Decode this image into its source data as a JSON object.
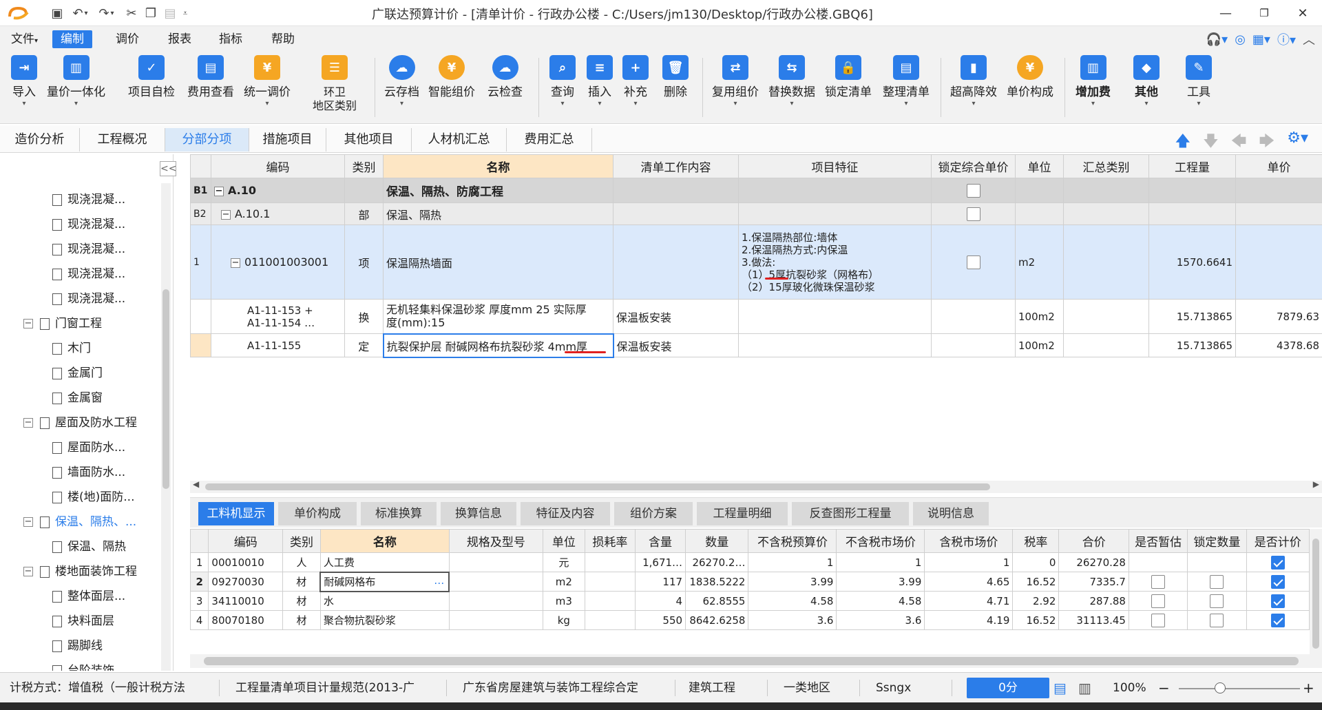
{
  "window": {
    "title": "广联达预算计价 - [清单计价 - 行政办公楼 - C:/Users/jm130/Desktop/行政办公楼.GBQ6]",
    "controls": {
      "minimize": "—",
      "restore": "❐",
      "close": "✕"
    }
  },
  "menu": {
    "items": [
      "文件",
      "编制",
      "调价",
      "报表",
      "指标",
      "帮助"
    ],
    "active": "编制"
  },
  "ribbon": {
    "buttons": [
      {
        "label": "导入",
        "icon": "import-icon",
        "color": "#2b7de9",
        "dd": true
      },
      {
        "label": "量价一体化",
        "icon": "integrate-icon",
        "color": "#2b7de9",
        "dd": true
      },
      {
        "label": "项目自检",
        "icon": "self-check-icon",
        "color": "#2b7de9",
        "dd": false
      },
      {
        "label": "费用查看",
        "icon": "fee-view-icon",
        "color": "#2b7de9",
        "dd": false
      },
      {
        "label": "统一调价",
        "icon": "unify-price-icon",
        "color": "#f5a623",
        "dd": true
      },
      {
        "label": "环卫\n地区类别",
        "icon": "region-icon",
        "color": "#f5a623",
        "dd": false
      },
      {
        "label": "云存档",
        "icon": "cloud-save-icon",
        "color": "#2b7de9",
        "dd": true
      },
      {
        "label": "智能组价",
        "icon": "smart-price-icon",
        "color": "#f5a623",
        "dd": false
      },
      {
        "label": "云检查",
        "icon": "cloud-check-icon",
        "color": "#2b7de9",
        "dd": false
      },
      {
        "label": "查询",
        "icon": "query-icon",
        "color": "#2b7de9",
        "dd": true
      },
      {
        "label": "插入",
        "icon": "insert-icon",
        "color": "#2b7de9",
        "dd": true
      },
      {
        "label": "补充",
        "icon": "supplement-icon",
        "color": "#2b7de9",
        "dd": true
      },
      {
        "label": "删除",
        "icon": "delete-icon",
        "color": "#2b7de9",
        "dd": false
      },
      {
        "label": "复用组价",
        "icon": "reuse-icon",
        "color": "#2b7de9",
        "dd": true
      },
      {
        "label": "替换数据",
        "icon": "replace-icon",
        "color": "#2b7de9",
        "dd": true
      },
      {
        "label": "锁定清单",
        "icon": "lock-icon",
        "color": "#2b7de9",
        "dd": false
      },
      {
        "label": "整理清单",
        "icon": "organize-icon",
        "color": "#2b7de9",
        "dd": true
      },
      {
        "label": "超高降效",
        "icon": "high-icon",
        "color": "#2b7de9",
        "dd": true
      },
      {
        "label": "单价构成",
        "icon": "unit-price-icon",
        "color": "#f5a623",
        "dd": false
      },
      {
        "label": "增加费",
        "icon": "add-fee-icon",
        "color": "#2b7de9",
        "dd": true
      },
      {
        "label": "其他",
        "icon": "other-icon",
        "color": "#2b7de9",
        "dd": true
      },
      {
        "label": "工具",
        "icon": "tool-icon",
        "color": "#2b7de9",
        "dd": true
      }
    ]
  },
  "nav_tabs": {
    "items": [
      "造价分析",
      "工程概况",
      "分部分项",
      "措施项目",
      "其他项目",
      "人材机汇总",
      "费用汇总"
    ],
    "active": "分部分项"
  },
  "tree": {
    "collapse_label": "<<",
    "nodes": [
      {
        "label": "现浇混凝...",
        "level": 2,
        "type": "doc"
      },
      {
        "label": "现浇混凝...",
        "level": 2,
        "type": "doc"
      },
      {
        "label": "现浇混凝...",
        "level": 2,
        "type": "doc"
      },
      {
        "label": "现浇混凝...",
        "level": 2,
        "type": "doc"
      },
      {
        "label": "现浇混凝...",
        "level": 2,
        "type": "doc"
      },
      {
        "label": "门窗工程",
        "level": 1,
        "type": "folder"
      },
      {
        "label": "木门",
        "level": 2,
        "type": "doc"
      },
      {
        "label": "金属门",
        "level": 2,
        "type": "doc"
      },
      {
        "label": "金属窗",
        "level": 2,
        "type": "doc"
      },
      {
        "label": "屋面及防水工程",
        "level": 1,
        "type": "folder"
      },
      {
        "label": "屋面防水...",
        "level": 2,
        "type": "doc"
      },
      {
        "label": "墙面防水...",
        "level": 2,
        "type": "doc"
      },
      {
        "label": "楼(地)面防...",
        "level": 2,
        "type": "doc"
      },
      {
        "label": "保温、隔热、...",
        "level": 1,
        "type": "folder",
        "selected": true
      },
      {
        "label": "保温、隔热",
        "level": 2,
        "type": "doc"
      },
      {
        "label": "楼地面装饰工程",
        "level": 1,
        "type": "folder"
      },
      {
        "label": "整体面层...",
        "level": 2,
        "type": "doc"
      },
      {
        "label": "块料面层",
        "level": 2,
        "type": "doc"
      },
      {
        "label": "踢脚线",
        "level": 2,
        "type": "doc"
      },
      {
        "label": "台阶装饰",
        "level": 2,
        "type": "doc"
      }
    ]
  },
  "main_grid": {
    "headers": [
      "编码",
      "类别",
      "名称",
      "清单工作内容",
      "项目特征",
      "锁定综合单价",
      "单位",
      "汇总类别",
      "工程量",
      "单价"
    ],
    "rows": [
      {
        "idx": "B1",
        "code": "A.10",
        "type": "",
        "name": "保温、隔热、防腐工程",
        "content": "",
        "feature": "",
        "lock": false,
        "unit": "",
        "sum": "",
        "qty": "",
        "price": ""
      },
      {
        "idx": "B2",
        "code": "A.10.1",
        "type": "部",
        "name": "保温、隔热",
        "content": "",
        "feature": "",
        "lock": false,
        "unit": "",
        "sum": "",
        "qty": "",
        "price": ""
      },
      {
        "idx": "1",
        "code": "011001003001",
        "type": "项",
        "name": "保温隔热墙面",
        "content": "",
        "feature": [
          "1.保温隔热部位:墙体",
          "2.保温隔热方式:内保温",
          "3.做法:",
          "（1）5厚抗裂砂浆（网格布）",
          "（2）15厚玻化微珠保温砂浆"
        ],
        "lock": false,
        "unit": "m2",
        "sum": "",
        "qty": "1570.6641",
        "price": ""
      },
      {
        "idx": "",
        "code": [
          "A1-11-153 +",
          "A1-11-154 …"
        ],
        "type": "换",
        "name": [
          "无机轻集料保温砂浆 厚度mm 25  实际厚",
          "度(mm):15"
        ],
        "content": "保温板安装",
        "feature": "",
        "unit": "100m2",
        "sum": "",
        "qty": "15.713865",
        "price": "7879.63"
      },
      {
        "idx": "",
        "code": "A1-11-155",
        "type": "定",
        "name": "抗裂保护层 耐碱网格布抗裂砂浆 4mm厚",
        "content": "保温板安装",
        "feature": "",
        "unit": "100m2",
        "sum": "",
        "qty": "15.713865",
        "price": "4378.68"
      }
    ]
  },
  "bottom_tabs": {
    "items": [
      "工料机显示",
      "单价构成",
      "标准换算",
      "换算信息",
      "特征及内容",
      "组价方案",
      "工程量明细",
      "反查图形工程量",
      "说明信息"
    ],
    "active": "工料机显示"
  },
  "bottom_grid": {
    "headers": [
      "编码",
      "类别",
      "名称",
      "规格及型号",
      "单位",
      "损耗率",
      "含量",
      "数量",
      "不含税预算价",
      "不含税市场价",
      "含税市场价",
      "税率",
      "合价",
      "是否暂估",
      "锁定数量",
      "是否计价"
    ],
    "rows": [
      {
        "idx": "1",
        "code": "00010010",
        "type": "人",
        "name": "人工费",
        "spec": "",
        "unit": "元",
        "loss": "",
        "content": "1,671…",
        "qty": "26270.2…",
        "p1": "1",
        "p2": "1",
        "p3": "1",
        "tax": "0",
        "total": "26270.28",
        "est": null,
        "lockq": null,
        "priced": true
      },
      {
        "idx": "2",
        "code": "09270030",
        "type": "材",
        "name": "耐碱网格布",
        "spec": "",
        "unit": "m2",
        "loss": "",
        "content": "117",
        "qty": "1838.5222",
        "p1": "3.99",
        "p2": "3.99",
        "p3": "4.65",
        "tax": "16.52",
        "total": "7335.7",
        "est": false,
        "lockq": false,
        "priced": true
      },
      {
        "idx": "3",
        "code": "34110010",
        "type": "材",
        "name": "水",
        "spec": "",
        "unit": "m3",
        "loss": "",
        "content": "4",
        "qty": "62.8555",
        "p1": "4.58",
        "p2": "4.58",
        "p3": "4.71",
        "tax": "2.92",
        "total": "287.88",
        "est": false,
        "lockq": false,
        "priced": true
      },
      {
        "idx": "4",
        "code": "80070180",
        "type": "材",
        "name": "聚合物抗裂砂浆",
        "spec": "",
        "unit": "kg",
        "loss": "",
        "content": "550",
        "qty": "8642.6258",
        "p1": "3.6",
        "p2": "3.6",
        "p3": "4.19",
        "tax": "16.52",
        "total": "31113.45",
        "est": false,
        "lockq": false,
        "priced": true
      }
    ]
  },
  "status": {
    "tax_method": "计税方式：增值税（一般计税方法",
    "spec": "工程量清单项目计量规范(2013-广",
    "quota": "广东省房屋建筑与装饰工程综合定",
    "discipline": "建筑工程",
    "region": "一类地区",
    "user": "Ssngx",
    "score": "0分",
    "zoom": "100%"
  },
  "colors": {
    "accent": "#2b7de9",
    "orange": "#f5a623",
    "selected_row": "#dbe9fb",
    "group_row": "#d8d8d8"
  }
}
